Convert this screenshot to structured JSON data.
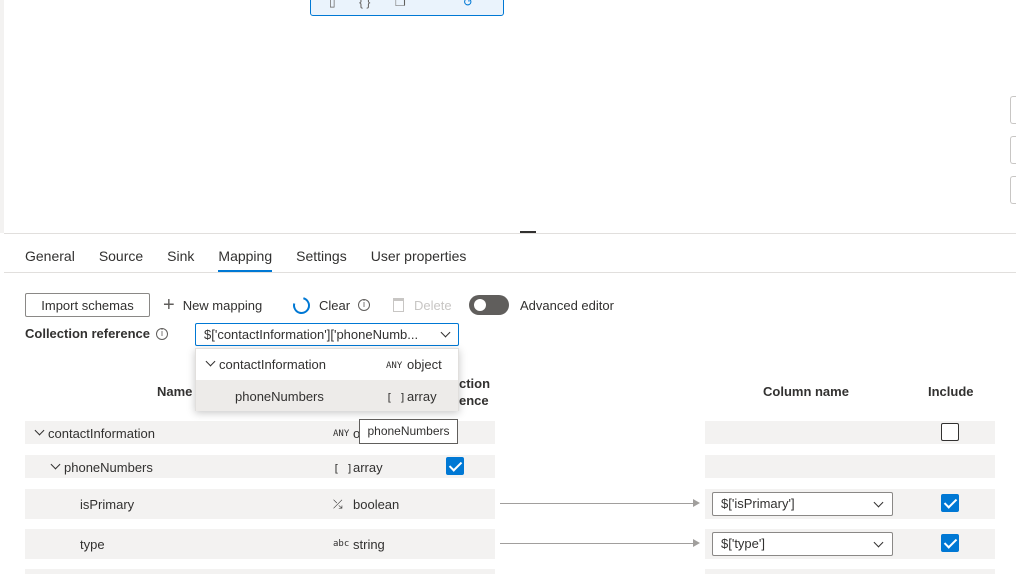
{
  "tabs": [
    {
      "label": "General"
    },
    {
      "label": "Source"
    },
    {
      "label": "Sink"
    },
    {
      "label": "Mapping",
      "active": true
    },
    {
      "label": "Settings"
    },
    {
      "label": "User properties"
    }
  ],
  "toolbar": {
    "import_schemas": "Import schemas",
    "new_mapping": "New mapping",
    "clear": "Clear",
    "delete": "Delete",
    "advanced_editor": "Advanced editor"
  },
  "collection_reference": {
    "label": "Collection reference",
    "value": "$['contactInformation']['phoneNumb..."
  },
  "dropdown": {
    "items": [
      {
        "name": "contactInformation",
        "type_icon": "ANY",
        "type": "object"
      },
      {
        "name": "phoneNumbers",
        "type_icon": "[ ]",
        "type": "array",
        "selected": true
      }
    ]
  },
  "table": {
    "headers": {
      "name": "Name",
      "collection_ref_line1": "ction",
      "collection_ref_line2": "ence",
      "column_name": "Column name",
      "include": "Include"
    },
    "rows": [
      {
        "name": "contactInformation",
        "type_icon": "ANY",
        "type": "o",
        "column": "",
        "include": false
      },
      {
        "name": "phoneNumbers",
        "type_icon": "[ ]",
        "type": "array",
        "column": "",
        "include": true
      },
      {
        "name": "isPrimary",
        "type_icon": "⤰",
        "type": "boolean",
        "column": "$['isPrimary']",
        "include": true
      },
      {
        "name": "type",
        "type_icon": "abc",
        "type": "string",
        "column": "$['type']",
        "include": true
      }
    ]
  },
  "tooltip": "phoneNumbers",
  "colors": {
    "accent": "#0078d4",
    "text": "#323130",
    "row_bg": "#f3f2f1"
  }
}
